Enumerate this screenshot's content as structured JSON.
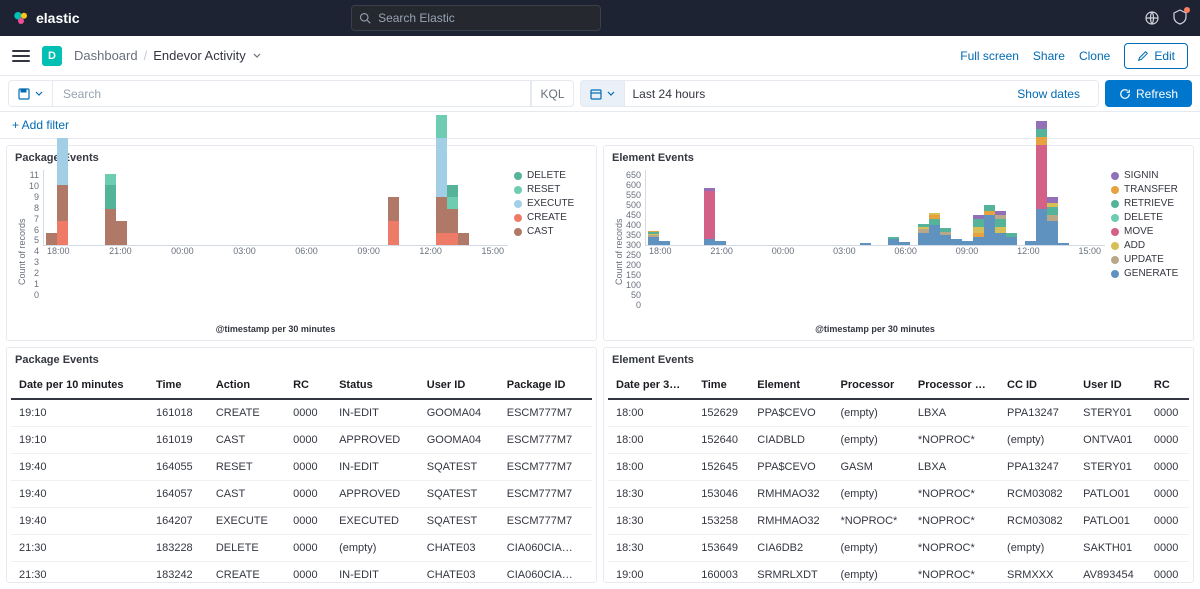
{
  "topbar": {
    "brand": "elastic",
    "search_placeholder": "Search Elastic"
  },
  "header": {
    "badge_letter": "D",
    "breadcrumb_root": "Dashboard",
    "breadcrumb_current": "Endevor Activity",
    "actions": {
      "fullscreen": "Full screen",
      "share": "Share",
      "clone": "Clone",
      "edit": "Edit"
    }
  },
  "filterbar": {
    "search_placeholder": "Search",
    "kql": "KQL",
    "date_range": "Last 24 hours",
    "show_dates": "Show dates",
    "refresh": "Refresh",
    "add_filter": "+ Add filter"
  },
  "colors": {
    "DELETE": "#54b399",
    "RESET": "#6dccb1",
    "EXECUTE": "#a2cfe6",
    "CREATE": "#ee7b68",
    "CAST": "#b07866",
    "SIGNIN": "#9170b8",
    "TRANSFER": "#e7a23f",
    "RETRIEVE": "#54b399",
    "DELETE2": "#6dccb1",
    "MOVE": "#d36086",
    "ADD": "#d6bf57",
    "UPDATE": "#b9a888",
    "GENERATE": "#6092c0"
  },
  "panel_titles": {
    "p1": "Package Events",
    "p2": "Element Events",
    "p3": "Package Events",
    "p4": "Element Events"
  },
  "chart_data": [
    {
      "type": "bar",
      "title": "Package Events",
      "xlabel": "@timestamp per 30 minutes",
      "ylabel": "Count of records",
      "ylim": [
        0,
        11
      ],
      "yticks": [
        0,
        1,
        2,
        3,
        4,
        5,
        6,
        7,
        8,
        9,
        10,
        11
      ],
      "categories": [
        "18:00",
        "21:00",
        "00:00",
        "03:00",
        "06:00",
        "09:00",
        "12:00",
        "15:00"
      ],
      "legend": [
        "DELETE",
        "RESET",
        "EXECUTE",
        "CREATE",
        "CAST"
      ],
      "stacks": [
        {
          "x": "18:05",
          "v": {
            "CAST": 1
          }
        },
        {
          "x": "18:30",
          "v": {
            "CREATE": 2,
            "CAST": 3,
            "EXECUTE": 4
          }
        },
        {
          "x": "21:00",
          "v": {
            "CAST": 3,
            "DELETE": 2,
            "RESET": 1
          }
        },
        {
          "x": "21:30",
          "v": {
            "CAST": 2
          }
        },
        {
          "x": "12:00",
          "v": {
            "CREATE": 2,
            "CAST": 2
          }
        },
        {
          "x": "14:30",
          "v": {
            "CREATE": 1,
            "CAST": 3,
            "EXECUTE": 5,
            "RESET": 2
          }
        },
        {
          "x": "15:00",
          "v": {
            "CREATE": 1,
            "CAST": 2,
            "RESET": 1,
            "DELETE": 1
          }
        },
        {
          "x": "15:30",
          "v": {
            "CAST": 1
          }
        }
      ]
    },
    {
      "type": "bar",
      "title": "Element Events",
      "xlabel": "@timestamp per 30 minutes",
      "ylabel": "Count of records",
      "ylim": [
        0,
        650
      ],
      "yticks": [
        0,
        50,
        100,
        150,
        200,
        250,
        300,
        350,
        400,
        450,
        500,
        550,
        600,
        650
      ],
      "categories": [
        "18:00",
        "21:00",
        "00:00",
        "03:00",
        "06:00",
        "09:00",
        "12:00",
        "15:00"
      ],
      "legend": [
        "SIGNIN",
        "TRANSFER",
        "RETRIEVE",
        "DELETE",
        "MOVE",
        "ADD",
        "UPDATE",
        "GENERATE"
      ],
      "stacks": [
        {
          "x": "18:00",
          "v": {
            "GENERATE": 40,
            "UPDATE": 10,
            "ADD": 5,
            "RETRIEVE": 10,
            "TRANSFER": 5
          }
        },
        {
          "x": "18:30",
          "v": {
            "GENERATE": 20
          }
        },
        {
          "x": "21:00",
          "v": {
            "GENERATE": 30,
            "MOVE": 240,
            "SIGNIN": 15
          }
        },
        {
          "x": "21:30",
          "v": {
            "GENERATE": 20
          }
        },
        {
          "x": "06:00",
          "v": {
            "GENERATE": 10
          }
        },
        {
          "x": "07:30",
          "v": {
            "GENERATE": 30,
            "RETRIEVE": 10
          }
        },
        {
          "x": "08:00",
          "v": {
            "GENERATE": 15
          }
        },
        {
          "x": "09:00",
          "v": {
            "GENERATE": 60,
            "UPDATE": 20,
            "ADD": 10,
            "RETRIEVE": 15
          }
        },
        {
          "x": "09:30",
          "v": {
            "GENERATE": 100,
            "RETRIEVE": 30,
            "TRANSFER": 20,
            "ADD": 10
          }
        },
        {
          "x": "10:00",
          "v": {
            "GENERATE": 50,
            "UPDATE": 15,
            "RETRIEVE": 20
          }
        },
        {
          "x": "10:30",
          "v": {
            "GENERATE": 30
          }
        },
        {
          "x": "11:00",
          "v": {
            "GENERATE": 20
          }
        },
        {
          "x": "11:30",
          "v": {
            "GENERATE": 40,
            "TRANSFER": 20,
            "ADD": 30,
            "RETRIEVE": 40,
            "SIGNIN": 20
          }
        },
        {
          "x": "12:00",
          "v": {
            "GENERATE": 150,
            "TRANSFER": 20,
            "RETRIEVE": 30
          }
        },
        {
          "x": "12:30",
          "v": {
            "GENERATE": 60,
            "ADD": 30,
            "RETRIEVE": 40,
            "UPDATE": 20,
            "SIGNIN": 20
          }
        },
        {
          "x": "13:00",
          "v": {
            "GENERATE": 40,
            "RETRIEVE": 20
          }
        },
        {
          "x": "14:00",
          "v": {
            "GENERATE": 20
          }
        },
        {
          "x": "14:30",
          "v": {
            "GENERATE": 180,
            "MOVE": 320,
            "TRANSFER": 40,
            "RETRIEVE": 40,
            "SIGNIN": 40
          }
        },
        {
          "x": "15:00",
          "v": {
            "GENERATE": 120,
            "UPDATE": 30,
            "RETRIEVE": 40,
            "ADD": 20,
            "SIGNIN": 30
          }
        },
        {
          "x": "15:30",
          "v": {
            "GENERATE": 10
          }
        }
      ]
    }
  ],
  "package_table": {
    "headers": [
      "Date per 10 minutes",
      "Time",
      "Action",
      "RC",
      "Status",
      "User ID",
      "Package ID"
    ],
    "rows": [
      [
        "19:10",
        "161018",
        "CREATE",
        "0000",
        "IN-EDIT",
        "GOOMA04",
        "ESCM777M7"
      ],
      [
        "19:10",
        "161019",
        "CAST",
        "0000",
        "APPROVED",
        "GOOMA04",
        "ESCM777M7"
      ],
      [
        "19:40",
        "164055",
        "RESET",
        "0000",
        "IN-EDIT",
        "SQATEST",
        "ESCM777M7"
      ],
      [
        "19:40",
        "164057",
        "CAST",
        "0000",
        "APPROVED",
        "SQATEST",
        "ESCM777M7"
      ],
      [
        "19:40",
        "164207",
        "EXECUTE",
        "0000",
        "EXECUTED",
        "SQATEST",
        "ESCM777M7"
      ],
      [
        "21:30",
        "183228",
        "DELETE",
        "0000",
        "(empty)",
        "CHATE03",
        "CIA060CIA…"
      ],
      [
        "21:30",
        "183242",
        "CREATE",
        "0000",
        "IN-EDIT",
        "CHATE03",
        "CIA060CIA…"
      ]
    ]
  },
  "element_table": {
    "headers": [
      "Date per 3…",
      "Time",
      "Element",
      "Processor",
      "Processor …",
      "CC ID",
      "User ID",
      "RC"
    ],
    "rows": [
      [
        "18:00",
        "152629",
        "PPA$CEVO",
        "(empty)",
        "LBXA",
        "PPA13247",
        "STERY01",
        "0000"
      ],
      [
        "18:00",
        "152640",
        "CIADBLD",
        "(empty)",
        "*NOPROC*",
        "(empty)",
        "ONTVA01",
        "0000"
      ],
      [
        "18:00",
        "152645",
        "PPA$CEVO",
        "GASM",
        "LBXA",
        "PPA13247",
        "STERY01",
        "0000"
      ],
      [
        "18:30",
        "153046",
        "RMHMAO32",
        "(empty)",
        "*NOPROC*",
        "RCM03082",
        "PATLO01",
        "0000"
      ],
      [
        "18:30",
        "153258",
        "RMHMAO32",
        "*NOPROC*",
        "*NOPROC*",
        "RCM03082",
        "PATLO01",
        "0000"
      ],
      [
        "18:30",
        "153649",
        "CIA6DB2",
        "(empty)",
        "*NOPROC*",
        "(empty)",
        "SAKTH01",
        "0000"
      ],
      [
        "19:00",
        "160003",
        "SRMRLXDT",
        "(empty)",
        "*NOPROC*",
        "SRMXXX",
        "AV893454",
        "0000"
      ]
    ]
  }
}
